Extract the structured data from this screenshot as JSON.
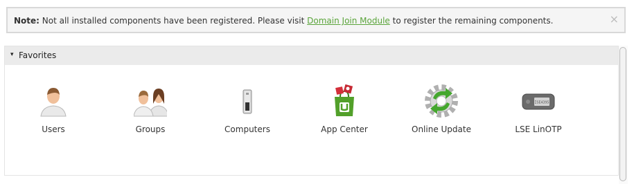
{
  "notice": {
    "prefix": "Note:",
    "text_before": " Not all installed components have been registered. Please visit ",
    "link": "Domain Join Module",
    "text_after": " to register the remaining components.",
    "close": "×"
  },
  "favorites": {
    "caret": "▾",
    "title": "Favorites",
    "items": [
      {
        "label": "Users",
        "icon": "user-icon"
      },
      {
        "label": "Groups",
        "icon": "group-icon"
      },
      {
        "label": "Computers",
        "icon": "computer-icon"
      },
      {
        "label": "App Center",
        "icon": "app-center-icon"
      },
      {
        "label": "Online Update",
        "icon": "online-update-icon"
      },
      {
        "label": "LSE LinOTP",
        "icon": "otp-token-icon"
      }
    ]
  },
  "otp_token_text": "ISE4395",
  "colors": {
    "link": "#5aa43a",
    "header_bg": "#ebebeb",
    "notice_bg": "#f5f5f5"
  }
}
